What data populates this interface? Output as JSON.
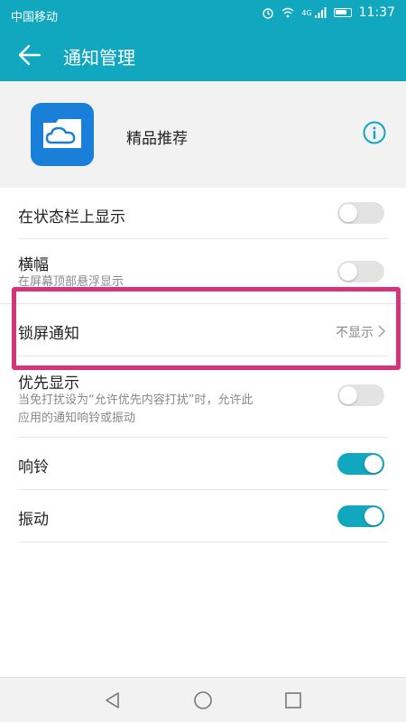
{
  "status_bar": {
    "carrier": "中国移动",
    "network": "4G",
    "time": "11:37"
  },
  "app_bar": {
    "title": "通知管理"
  },
  "app": {
    "name": "精品推荐"
  },
  "settings": [
    {
      "label": "在状态栏上显示",
      "toggle": "off"
    },
    {
      "label": "横幅",
      "subtitle": "在屏幕顶部悬浮显示",
      "toggle": "off"
    },
    {
      "label": "锁屏通知",
      "value": "不显示"
    },
    {
      "label": "优先显示",
      "subtitle_line1": "当免打扰设为“允许优先内容打扰”时，允许此",
      "subtitle_line2": "应用的通知响铃或振动",
      "toggle": "off"
    },
    {
      "label": "响铃",
      "toggle": "on"
    },
    {
      "label": "振动",
      "toggle": "on"
    }
  ],
  "colors": {
    "accent": "#10a7bf",
    "highlight": "#d6337a",
    "app_icon": "#1a7fd8"
  }
}
